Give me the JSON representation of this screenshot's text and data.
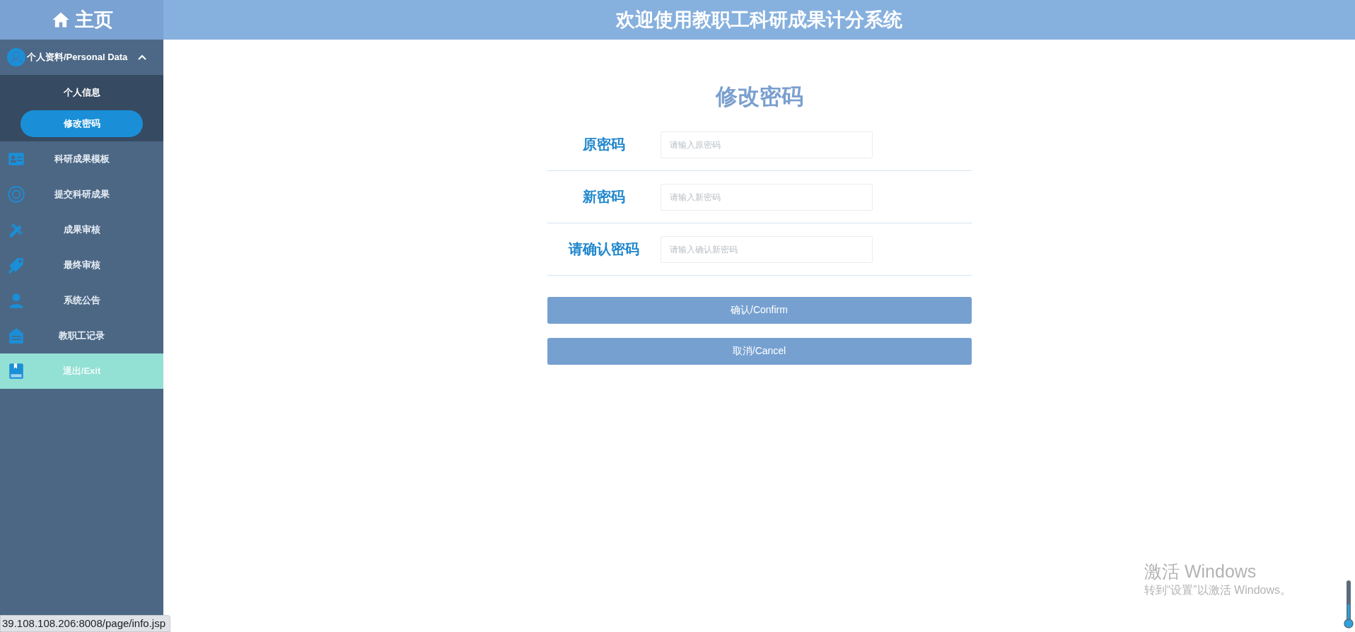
{
  "header": {
    "home": "主页",
    "title": "欢迎使用教职工科研成果计分系统"
  },
  "sidebar": {
    "group": {
      "label": "个人资料/Personal Data",
      "expanded": true,
      "children": [
        {
          "label": "个人信息",
          "selected": false
        },
        {
          "label": "修改密码",
          "selected": true
        }
      ]
    },
    "items": [
      {
        "label": "科研成果模板",
        "kind": "card",
        "highlighted": false
      },
      {
        "label": "提交科研成果",
        "kind": "ring",
        "highlighted": false
      },
      {
        "label": "成果审核",
        "kind": "pencil",
        "highlighted": false
      },
      {
        "label": "最终审核",
        "kind": "tag",
        "highlighted": false
      },
      {
        "label": "系统公告",
        "kind": "people",
        "highlighted": false
      },
      {
        "label": "教职工记录",
        "kind": "board",
        "highlighted": false
      },
      {
        "label": "退出/Exit",
        "kind": "book",
        "highlighted": true
      }
    ]
  },
  "form": {
    "title": "修改密码",
    "fields": [
      {
        "label": "原密码",
        "placeholder": "请输入原密码"
      },
      {
        "label": "新密码",
        "placeholder": "请输入新密码"
      },
      {
        "label": "请确认密码",
        "placeholder": "请输入确认新密码"
      }
    ],
    "buttons": [
      "确认/Confirm",
      "取消/Cancel"
    ]
  },
  "status_bar": {
    "url": "39.108.108.206:8008/page/info.jsp"
  },
  "activation_notice": {
    "title": "激活 Windows",
    "text": "转到“设置”以激活 Windows。"
  }
}
